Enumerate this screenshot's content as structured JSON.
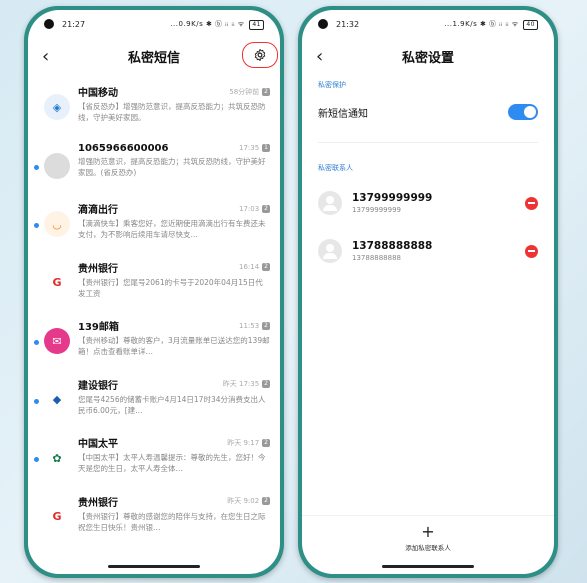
{
  "left": {
    "status": {
      "time": "21:27",
      "net": "...0.9K/s ✱ ⓑ ᵢᵢ ᵢᵢ ᯤ",
      "battery": "41"
    },
    "title": "私密短信",
    "messages": [
      {
        "name": "中国移动",
        "time": "58分钟前",
        "sim": "2",
        "text": "【省反恐办】增强防范意识，提高反恐能力；共筑反恐防线，守护美好家园。",
        "avatar_color": "#e8f1fb",
        "avatar_text": "◈",
        "avatar_fg": "#1f78d1",
        "unread": false
      },
      {
        "name": "1065966600006",
        "time": "17:35",
        "sim": "1",
        "text": "增强防范意识，提高反恐能力；共筑反恐防线，守护美好家园。(省反恐办)",
        "avatar_color": "#dcdcdc",
        "avatar_text": "",
        "avatar_fg": "#fff",
        "unread": true
      },
      {
        "name": "滴滴出行",
        "time": "17:03",
        "sim": "2",
        "text": "【滴滴快车】乘客您好，您近期使用滴滴出行有车费还未支付，为不影响后续用车请尽快支…",
        "avatar_color": "#fff3e6",
        "avatar_text": "◡",
        "avatar_fg": "#ff7d1a",
        "unread": true
      },
      {
        "name": "贵州银行",
        "time": "16:14",
        "sim": "2",
        "text": "【贵州银行】您尾号2061的卡号于2020年04月15日代发工资",
        "avatar_color": "#ffffff",
        "avatar_text": "G",
        "avatar_fg": "#e32b2b",
        "unread": false
      },
      {
        "name": "139邮箱",
        "time": "11:53",
        "sim": "2",
        "text": "【贵州移动】尊敬的客户，3月流量账单已送达您的139邮箱！点击查看账单详…",
        "avatar_color": "#e5398c",
        "avatar_text": "✉",
        "avatar_fg": "#fff",
        "unread": true
      },
      {
        "name": "建设银行",
        "time": "昨天 17:35",
        "sim": "2",
        "text": "您尾号4256的储蓄卡账户4月14日17时34分消费支出人民币6.00元，[建…",
        "avatar_color": "#ffffff",
        "avatar_text": "◆",
        "avatar_fg": "#1a5fb4",
        "unread": true
      },
      {
        "name": "中国太平",
        "time": "昨天 9:17",
        "sim": "2",
        "text": "【中国太平】太平人寿温馨提示：尊敬的先生，您好！今天是您的生日，太平人寿全体…",
        "avatar_color": "#ffffff",
        "avatar_text": "✿",
        "avatar_fg": "#0f7a4a",
        "unread": true
      },
      {
        "name": "贵州银行",
        "time": "昨天 9:02",
        "sim": "2",
        "text": "【贵州银行】尊敬的感谢您的陪伴与支持，在您生日之际祝您生日快乐！贵州银…",
        "avatar_color": "#ffffff",
        "avatar_text": "G",
        "avatar_fg": "#e32b2b",
        "unread": false
      }
    ]
  },
  "right": {
    "status": {
      "time": "21:32",
      "net": "...1.9K/s ✱ ⓑ ᵢᵢ ᵢᵢ ᯤ",
      "battery": "40"
    },
    "title": "私密设置",
    "section_privacy": "私密保护",
    "toggle_label": "新短信通知",
    "toggle_on": true,
    "section_contacts": "私密联系人",
    "contacts": [
      {
        "name": "13799999999",
        "number": "13799999999"
      },
      {
        "name": "13788888888",
        "number": "13788888888"
      }
    ],
    "add_label": "添加私密联系人",
    "add_icon": "+"
  }
}
